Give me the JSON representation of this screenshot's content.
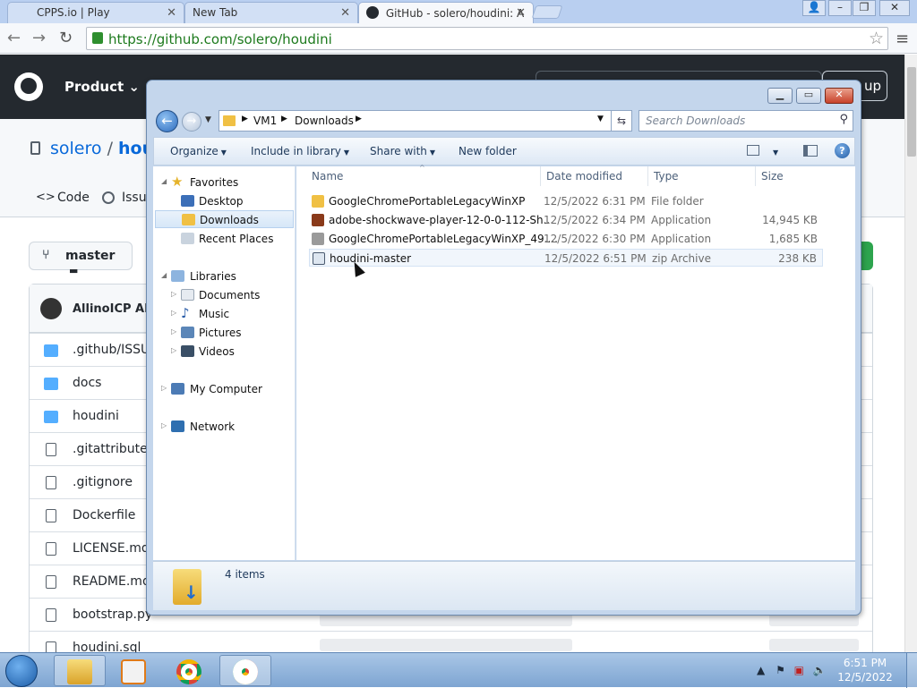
{
  "browser": {
    "tabs": [
      {
        "title": "CPPS.io | Play"
      },
      {
        "title": "New Tab"
      },
      {
        "title": "GitHub - solero/houdini: A"
      }
    ],
    "url": "https://github.com/solero/houdini"
  },
  "github": {
    "nav_product": "Product",
    "signup_label": "up",
    "owner": "solero",
    "separator": "/",
    "repo_partial": "houdi",
    "tab_code": "Code",
    "tab_issues": "Issu",
    "branch": "master",
    "commit_author": "AllinoICP AIC",
    "files": [
      {
        "name": ".github/ISSUE",
        "type": "folder"
      },
      {
        "name": "docs",
        "type": "folder"
      },
      {
        "name": "houdini",
        "type": "folder"
      },
      {
        "name": ".gitattributes",
        "type": "file"
      },
      {
        "name": ".gitignore",
        "type": "file"
      },
      {
        "name": "Dockerfile",
        "type": "file"
      },
      {
        "name": "LICENSE.md",
        "type": "file"
      },
      {
        "name": "README.md",
        "type": "file"
      },
      {
        "name": "bootstrap.py",
        "type": "file"
      },
      {
        "name": "houdini.sql",
        "type": "file"
      }
    ]
  },
  "explorer": {
    "breadcrumb": [
      "VM1",
      "Downloads"
    ],
    "search_placeholder": "Search Downloads",
    "commands": {
      "organize": "Organize",
      "include_library": "Include in library",
      "share_with": "Share with",
      "new_folder": "New folder"
    },
    "nav": {
      "favorites": "Favorites",
      "desktop": "Desktop",
      "downloads": "Downloads",
      "recent_places": "Recent Places",
      "libraries": "Libraries",
      "documents": "Documents",
      "music": "Music",
      "pictures": "Pictures",
      "videos": "Videos",
      "my_computer": "My Computer",
      "network": "Network"
    },
    "columns": {
      "name": "Name",
      "date": "Date modified",
      "type": "Type",
      "size": "Size"
    },
    "files": [
      {
        "name": "GoogleChromePortableLegacyWinXP",
        "date": "12/5/2022 6:31 PM",
        "type": "File folder",
        "size": "",
        "icon_color": "#f0c044"
      },
      {
        "name": "adobe-shockwave-player-12-0-0-112-Sh...",
        "date": "12/5/2022 6:34 PM",
        "type": "Application",
        "size": "14,945 KB",
        "icon_color": "#8a3a1a"
      },
      {
        "name": "GoogleChromePortableLegacyWinXP_49....",
        "date": "12/5/2022 6:30 PM",
        "type": "Application",
        "size": "1,685 KB",
        "icon_color": "#9a9a9a"
      },
      {
        "name": "houdini-master",
        "date": "12/5/2022 6:51 PM",
        "type": "zip Archive",
        "size": "238 KB",
        "icon_color": "#dde6f0"
      }
    ],
    "item_count": "4 items"
  },
  "taskbar": {
    "time": "6:51 PM",
    "date": "12/5/2022"
  }
}
